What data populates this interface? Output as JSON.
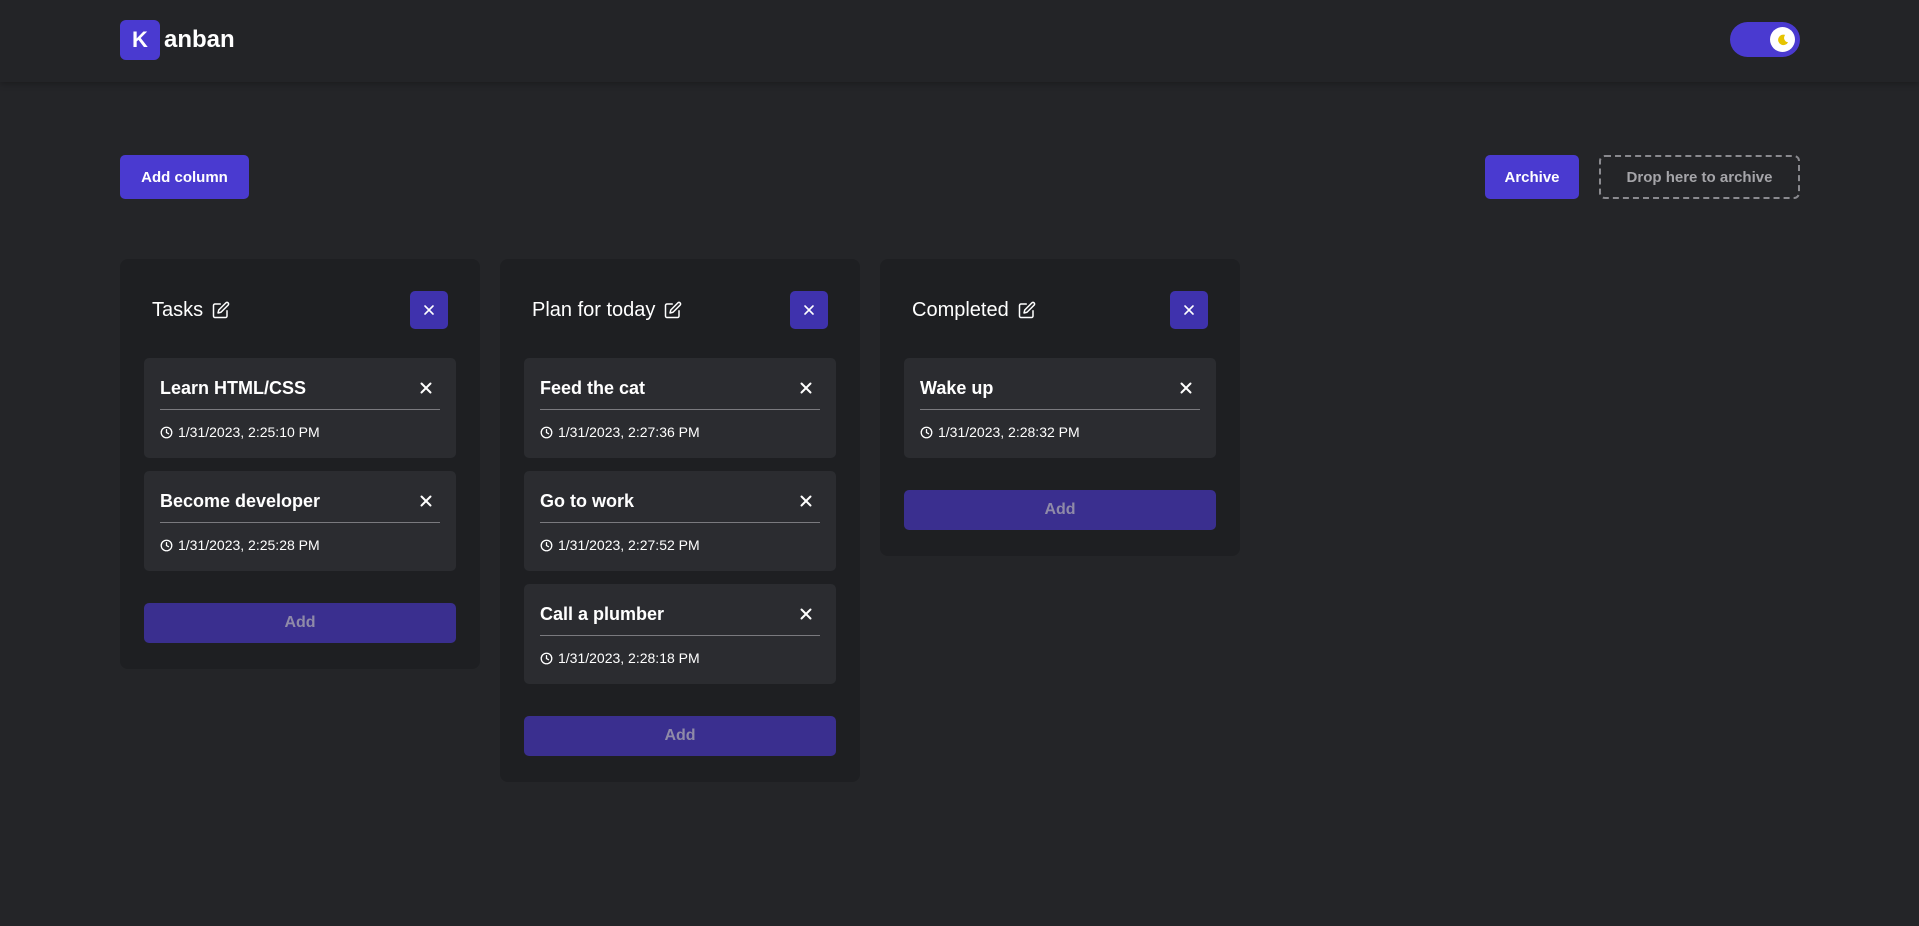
{
  "header": {
    "logo_letter": "K",
    "logo_text": "anban",
    "theme_toggle_icon": "moon-icon"
  },
  "toolbar": {
    "add_column_label": "Add column",
    "archive_label": "Archive",
    "dropzone_label": "Drop here to archive"
  },
  "colors": {
    "accent": "#4a3ad0",
    "background": "#242528",
    "column_bg": "#1e1f22",
    "card_bg": "#2b2c30",
    "add_button_bg": "#3a2f8f"
  },
  "columns": [
    {
      "title": "Tasks",
      "add_label": "Add",
      "cards": [
        {
          "title": "Learn HTML/CSS",
          "time": "1/31/2023, 2:25:10 PM"
        },
        {
          "title": "Become developer",
          "time": "1/31/2023, 2:25:28 PM"
        }
      ]
    },
    {
      "title": "Plan for today",
      "add_label": "Add",
      "cards": [
        {
          "title": "Feed the cat",
          "time": "1/31/2023, 2:27:36 PM"
        },
        {
          "title": "Go to work",
          "time": "1/31/2023, 2:27:52 PM"
        },
        {
          "title": "Call a plumber",
          "time": "1/31/2023, 2:28:18 PM"
        }
      ]
    },
    {
      "title": "Completed",
      "add_label": "Add",
      "cards": [
        {
          "title": "Wake up",
          "time": "1/31/2023, 2:28:32 PM"
        }
      ]
    }
  ]
}
